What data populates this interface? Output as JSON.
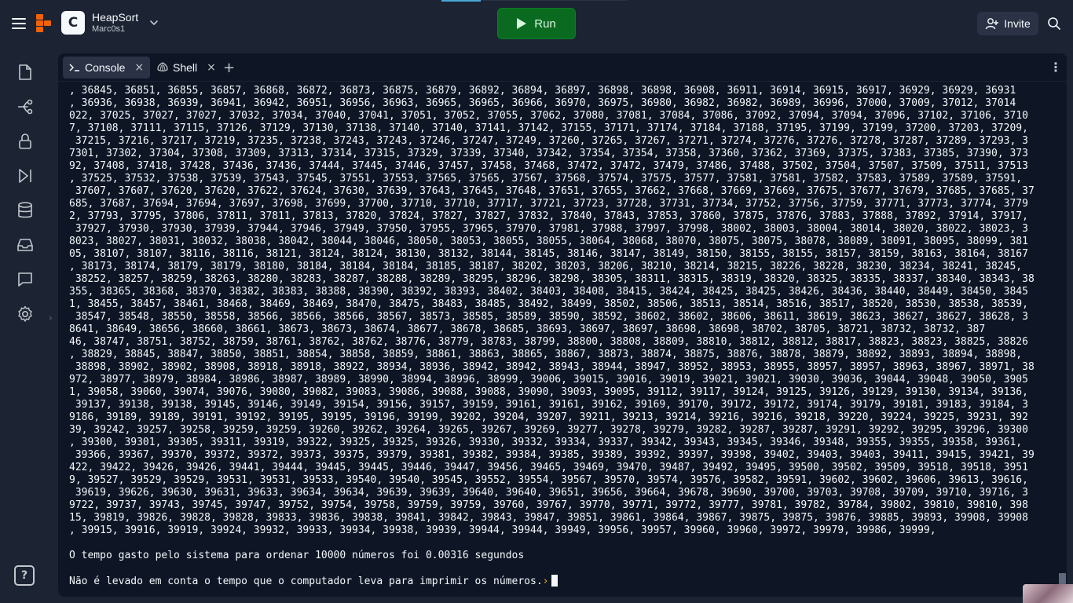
{
  "header": {
    "repl_name": "HeapSort",
    "repl_owner": "Marc0s1",
    "repl_icon_letter": "C",
    "run_label": "Run",
    "invite_label": "Invite"
  },
  "rail": {
    "items": [
      "files-icon",
      "git-icon",
      "secrets-icon",
      "debugger-icon",
      "database-icon",
      "packages-icon",
      "chat-icon",
      "settings-icon"
    ],
    "help_label": "?"
  },
  "tabs": [
    {
      "label": "Console",
      "icon": "console-icon",
      "active": true
    },
    {
      "label": "Shell",
      "icon": "shell-icon",
      "active": false
    }
  ],
  "console": {
    "output_lines": [
      ", 36845, 36851, 36855, 36857, 36868, 36872, 36873, 36875, 36879, 36892, 36894, 36897, 36898, 36898, 36908, 36911, 36914, 36915, 36917, 36929, 36929, 36931",
      ", 36936, 36938, 36939, 36941, 36942, 36951, 36956, 36963, 36965, 36965, 36966, 36970, 36975, 36980, 36982, 36982, 36989, 36996, 37000, 37009, 37012, 37014",
      "022, 37025, 37027, 37027, 37032, 37034, 37040, 37041, 37051, 37052, 37055, 37062, 37080, 37081, 37084, 37086, 37092, 37094, 37094, 37096, 37102, 37106, 3710",
      "7, 37108, 37111, 37115, 37126, 37129, 37130, 37138, 37140, 37140, 37141, 37142, 37155, 37171, 37174, 37184, 37188, 37195, 37199, 37199, 37200, 37203, 37209,",
      " 37215, 37216, 37217, 37219, 37235, 37238, 37243, 37243, 37246, 37247, 37249, 37260, 37265, 37267, 37271, 37274, 37276, 37276, 37278, 37287, 37289, 37293, 3",
      "7301, 37302, 37304, 37308, 37309, 37313, 37314, 37315, 37329, 37339, 37340, 37342, 37354, 37354, 37358, 37360, 37362, 37369, 37375, 37383, 37385, 37390, 373",
      "92, 37408, 37418, 37428, 37436, 37436, 37444, 37445, 37446, 37457, 37458, 37468, 37472, 37472, 37479, 37486, 37488, 37502, 37504, 37507, 37509, 37511, 37513",
      ", 37525, 37532, 37538, 37539, 37543, 37545, 37551, 37553, 37565, 37565, 37567, 37568, 37574, 37575, 37577, 37581, 37581, 37582, 37583, 37589, 37589, 37591,",
      " 37607, 37607, 37620, 37620, 37622, 37624, 37630, 37639, 37643, 37645, 37648, 37651, 37655, 37662, 37668, 37669, 37669, 37675, 37677, 37679, 37685, 37685, 37",
      "685, 37687, 37694, 37694, 37697, 37698, 37699, 37700, 37710, 37710, 37717, 37721, 37723, 37728, 37731, 37734, 37752, 37756, 37759, 37771, 37773, 37774, 3779",
      "2, 37793, 37795, 37806, 37811, 37811, 37813, 37820, 37824, 37827, 37827, 37832, 37840, 37843, 37853, 37860, 37875, 37876, 37883, 37888, 37892, 37914, 37917,",
      " 37927, 37930, 37930, 37939, 37944, 37946, 37949, 37950, 37955, 37965, 37970, 37981, 37988, 37997, 37998, 38002, 38003, 38004, 38014, 38020, 38022, 38023, 3",
      "8023, 38027, 38031, 38032, 38038, 38042, 38044, 38046, 38050, 38053, 38055, 38055, 38064, 38068, 38070, 38075, 38075, 38078, 38089, 38091, 38095, 38099, 381",
      "05, 38107, 38107, 38116, 38116, 38121, 38124, 38124, 38130, 38132, 38144, 38145, 38146, 38147, 38149, 38150, 38155, 38155, 38157, 38159, 38163, 38164, 38167",
      ", 38173, 38174, 38179, 38179, 38180, 38184, 38184, 38184, 38185, 38187, 38202, 38203, 38206, 38210, 38214, 38215, 38226, 38228, 38230, 38234, 38241, 38245,",
      " 38252, 38257, 38259, 38263, 38280, 38283, 38287, 38288, 38289, 38295, 38296, 38298, 38305, 38311, 38315, 38319, 38320, 38325, 38335, 38337, 38340, 38343, 38",
      "355, 38365, 38368, 38370, 38382, 38383, 38388, 38390, 38392, 38393, 38402, 38403, 38408, 38415, 38424, 38425, 38425, 38426, 38436, 38440, 38449, 38450, 3845",
      "1, 38455, 38457, 38461, 38468, 38469, 38469, 38470, 38475, 38483, 38485, 38492, 38499, 38502, 38506, 38513, 38514, 38516, 38517, 38520, 38530, 38538, 38539,",
      " 38547, 38548, 38550, 38558, 38566, 38566, 38566, 38567, 38573, 38585, 38589, 38590, 38592, 38602, 38602, 38606, 38611, 38619, 38623, 38627, 38627, 38628, 3",
      "8641, 38649, 38656, 38660, 38661, 38673, 38673, 38674, 38677, 38678, 38685, 38693, 38697, 38697, 38698, 38698, 38702, 38705, 38721, 38732, 38732, 387",
      "46, 38747, 38751, 38752, 38759, 38761, 38762, 38762, 38776, 38779, 38783, 38799, 38800, 38808, 38809, 38810, 38812, 38812, 38817, 38823, 38823, 38825, 38826",
      ", 38829, 38845, 38847, 38850, 38851, 38854, 38858, 38859, 38861, 38863, 38865, 38867, 38873, 38874, 38875, 38876, 38878, 38879, 38892, 38893, 38894, 38898,",
      " 38898, 38902, 38902, 38908, 38918, 38918, 38922, 38934, 38936, 38942, 38942, 38943, 38944, 38947, 38952, 38953, 38955, 38957, 38957, 38963, 38967, 38971, 38",
      "972, 38977, 38979, 38984, 38986, 38987, 38989, 38990, 38994, 38996, 38999, 39006, 39015, 39016, 39019, 39021, 39021, 39030, 39036, 39044, 39048, 39050, 3905",
      "1, 39058, 39060, 39074, 39076, 39080, 39082, 39083, 39086, 39088, 39088, 39090, 39093, 39095, 39112, 39117, 39124, 39125, 39126, 39129, 39130, 39134, 39136,",
      " 39137, 39138, 39138, 39145, 39146, 39149, 39154, 39156, 39157, 39159, 39161, 39161, 39162, 39169, 39170, 39172, 39172, 39174, 39179, 39181, 39183, 39184, 3",
      "9186, 39189, 39189, 39191, 39192, 39195, 39195, 39196, 39199, 39202, 39204, 39207, 39211, 39213, 39214, 39216, 39216, 39218, 39220, 39224, 39225, 39231, 392",
      "39, 39242, 39257, 39258, 39259, 39259, 39260, 39262, 39264, 39265, 39267, 39269, 39277, 39278, 39279, 39282, 39287, 39287, 39291, 39292, 39295, 39296, 39300",
      ", 39300, 39301, 39305, 39311, 39319, 39322, 39325, 39325, 39326, 39330, 39332, 39334, 39337, 39342, 39343, 39345, 39346, 39348, 39355, 39355, 39358, 39361,",
      " 39366, 39367, 39370, 39372, 39372, 39373, 39375, 39379, 39381, 39382, 39384, 39385, 39389, 39392, 39397, 39398, 39402, 39403, 39403, 39411, 39415, 39421, 39",
      "422, 39422, 39426, 39426, 39441, 39444, 39445, 39445, 39446, 39447, 39456, 39465, 39469, 39470, 39487, 39492, 39495, 39500, 39502, 39509, 39518, 39518, 3951",
      "9, 39527, 39529, 39529, 39531, 39531, 39533, 39540, 39540, 39545, 39552, 39554, 39567, 39570, 39574, 39576, 39582, 39591, 39602, 39602, 39606, 39613, 39616,",
      " 39619, 39626, 39630, 39631, 39633, 39634, 39634, 39639, 39639, 39640, 39640, 39651, 39656, 39664, 39678, 39690, 39700, 39703, 39708, 39709, 39710, 39716, 3",
      "9722, 39737, 39743, 39745, 39747, 39752, 39754, 39758, 39759, 39759, 39760, 39767, 39770, 39771, 39772, 39777, 39781, 39782, 39784, 39802, 39810, 39810, 398",
      "15, 39819, 39826, 39828, 39828, 39833, 39836, 39838, 39841, 39842, 39843, 39847, 39851, 39861, 39864, 39867, 39875, 39875, 39876, 39885, 39893, 39908, 39908",
      ", 39915, 39916, 39919, 39924, 39932, 39933, 39934, 39938, 39939, 39944, 39944, 39949, 39956, 39957, 39960, 39960, 39972, 39979, 39986, 39999,"
    ],
    "time_message": "O tempo gasto pelo sistema para ordenar 10000 números foi 0.00316 segundos",
    "note_message": "Não é levado em conta o tempo que o computador leva para imprimir os números.",
    "prompt_symbol": "›"
  }
}
